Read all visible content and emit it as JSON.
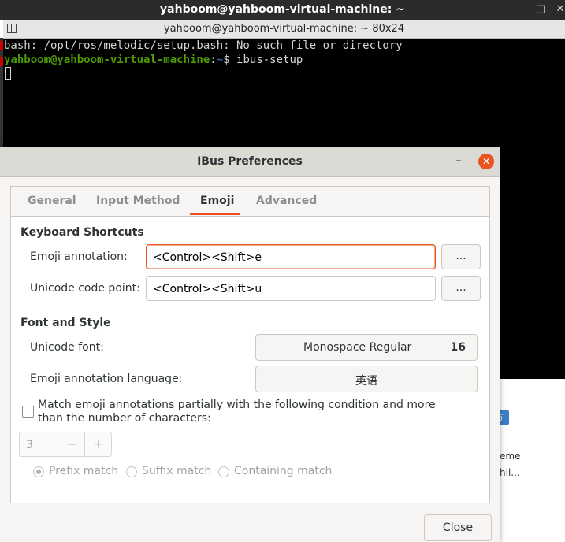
{
  "terminal": {
    "window_title": "yahboom@yahboom-virtual-machine: ~",
    "tab_title": "yahboom@yahboom-virtual-machine: ~ 80x24",
    "controls": {
      "minimize": "–",
      "maximize": "□",
      "close": "✕"
    },
    "lines": {
      "error": "bash: /opt/ros/melodic/setup.bash: No such file or directory",
      "prompt_user": "yahboom@yahboom-virtual-machine",
      "prompt_sep": ":",
      "prompt_path": "~",
      "prompt_symbol": "$ ",
      "command": "ibus-setup"
    }
  },
  "background_window": {
    "chip": "方",
    "frag1": "eme",
    "frag2": "hli..."
  },
  "dialog": {
    "title": "IBus Preferences",
    "minimize": "–",
    "close": "✕",
    "tabs": [
      {
        "label": "General",
        "active": false
      },
      {
        "label": "Input Method",
        "active": false
      },
      {
        "label": "Emoji",
        "active": true
      },
      {
        "label": "Advanced",
        "active": false
      }
    ],
    "keyboard_shortcuts": {
      "title": "Keyboard Shortcuts",
      "emoji_annotation_label": "Emoji annotation:",
      "emoji_annotation_value": "<Control><Shift>e",
      "unicode_code_point_label": "Unicode code point:",
      "unicode_code_point_value": "<Control><Shift>u",
      "edit_button_label": "..."
    },
    "font_and_style": {
      "title": "Font and Style",
      "unicode_font_label": "Unicode font:",
      "unicode_font_name": "Monospace Regular",
      "unicode_font_size": "16",
      "annotation_language_label": "Emoji annotation language:",
      "annotation_language_value": "英语"
    },
    "partial_match": {
      "checkbox_label": "Match emoji annotations partially with the following condition and more than the number of characters:",
      "checked": false,
      "spin_value": "3",
      "spin_minus": "−",
      "spin_plus": "+",
      "options": [
        {
          "label": "Prefix match",
          "selected": true
        },
        {
          "label": "Suffix match",
          "selected": false
        },
        {
          "label": "Containing match",
          "selected": false
        }
      ]
    },
    "close_button": "Close"
  },
  "colors": {
    "accent": "#e95420",
    "terminal_bg": "#000000",
    "prompt_green": "#4e9a06",
    "prompt_blue": "#3465a4"
  }
}
